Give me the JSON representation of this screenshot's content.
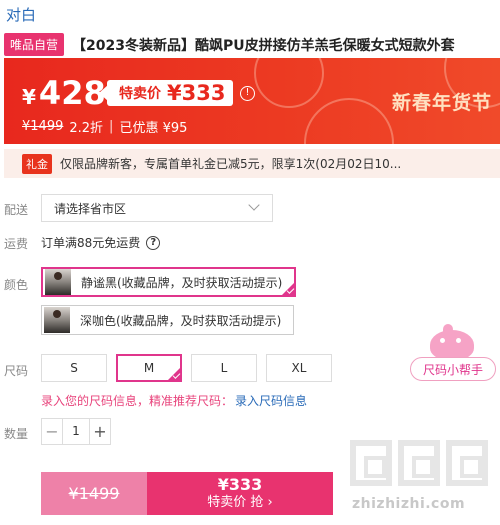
{
  "brand": "对白",
  "title": {
    "badge": "唯品自营",
    "text": "【2023冬装新品】酷飒PU皮拼接仿羊羔毛保暖女式短款外套"
  },
  "price": {
    "currency": "¥",
    "current": "428",
    "special_label": "特卖价",
    "special_value": "¥333",
    "original": "¥1499",
    "discount": "2.2折",
    "separator": "|",
    "saved": "已优惠 ¥95",
    "festival": "新春年货节"
  },
  "coupon": {
    "tag": "礼金",
    "text": "仅限品牌新客，专属首单礼金已减5元，限享1次(02月02日10..."
  },
  "labels": {
    "delivery": "配送",
    "freight": "运费",
    "color": "颜色",
    "size": "尺码",
    "quantity": "数量"
  },
  "delivery": {
    "placeholder": "请选择省市区"
  },
  "freight": {
    "text": "订单满88元免运费",
    "help_icon": "question-circle-icon"
  },
  "colors": [
    {
      "name": "静谧黑(收藏品牌，及时获取活动提示)",
      "selected": true
    },
    {
      "name": "深咖色(收藏品牌，及时获取活动提示)",
      "selected": false
    }
  ],
  "sizes": [
    {
      "label": "S",
      "selected": false
    },
    {
      "label": "M",
      "selected": true
    },
    {
      "label": "L",
      "selected": false
    },
    {
      "label": "XL",
      "selected": false
    }
  ],
  "size_info": {
    "text": "录入您的尺码信息，精准推荐尺码：",
    "link": "录入尺码信息"
  },
  "size_helper": {
    "label": "尺码小帮手"
  },
  "quantity": {
    "minus": "−",
    "value": "1",
    "plus": "+"
  },
  "buy": {
    "original": "¥1499",
    "price": "¥333",
    "action": "特卖价 抢 ›"
  },
  "watermark": {
    "text": "zhizhizhi.com"
  },
  "colors_theme": {
    "accent": "#e8336f",
    "banner": "#e8281e",
    "link": "#2a6bb8"
  }
}
